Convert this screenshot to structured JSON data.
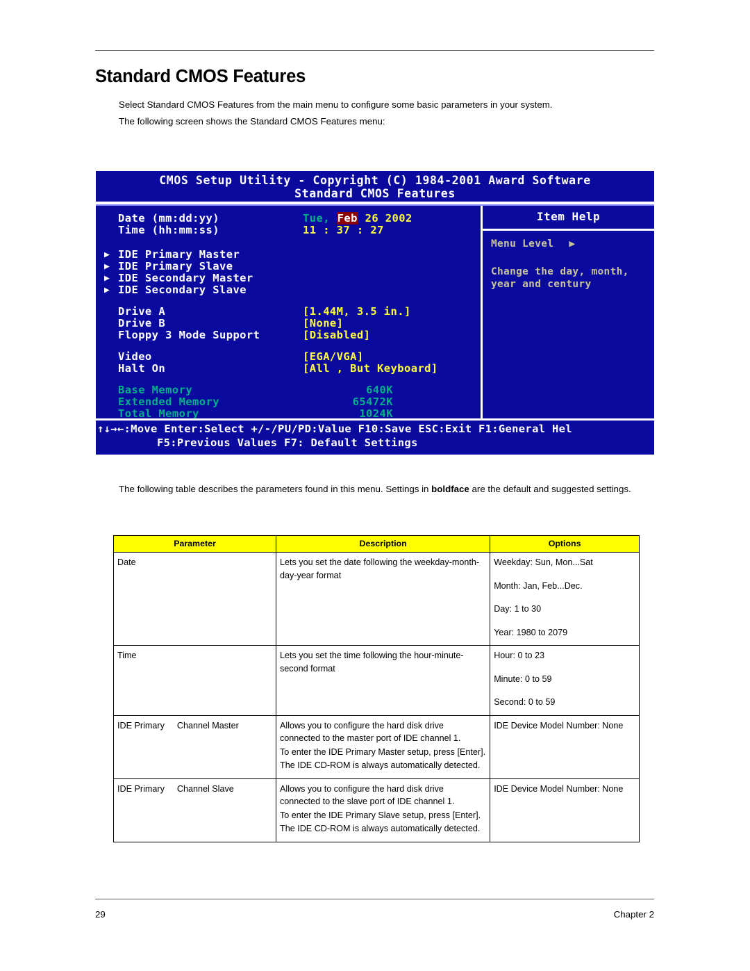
{
  "document": {
    "title": "Standard CMOS Features",
    "intro_line_1": "Select Standard CMOS Features from the main menu to configure some basic parameters in your system.",
    "intro_line_2": "The following screen shows the Standard CMOS Features menu:",
    "table_intro_prefix": "The following table describes the parameters found in this menu.  Settings in ",
    "table_intro_bold": "boldface",
    "table_intro_suffix": " are the default and suggested settings.",
    "footer_page_number": "29",
    "footer_chapter": "Chapter 2"
  },
  "bios": {
    "title_line_1": "CMOS Setup Utility - Copyright (C) 1984-2001 Award Software",
    "title_line_2": "Standard CMOS Features",
    "date": {
      "label": "Date (mm:dd:yy)",
      "weekday": "Tue,",
      "month": "Feb",
      "day_year": "26 2002"
    },
    "time": {
      "label": "Time (hh:mm:ss)",
      "value": "11 : 37 : 27"
    },
    "ide_items": [
      {
        "marker": "▶",
        "label": "IDE Primary Master"
      },
      {
        "marker": "▶",
        "label": "IDE Primary Slave"
      },
      {
        "marker": "▶",
        "label": "IDE Secondary Master"
      },
      {
        "marker": "▶",
        "label": "IDE Secondary Slave"
      }
    ],
    "settings": [
      {
        "label": "Drive A",
        "value": "[1.44M, 3.5 in.]"
      },
      {
        "label": "Drive B",
        "value": "[None]"
      },
      {
        "label": "Floppy 3 Mode Support",
        "value": "[Disabled]"
      }
    ],
    "settings2": [
      {
        "label": "Video",
        "value": "[EGA/VGA]"
      },
      {
        "label": "Halt On",
        "value": "[All , But Keyboard]"
      }
    ],
    "memory": [
      {
        "label": "Base Memory",
        "value": "640K"
      },
      {
        "label": "Extended Memory",
        "value": "65472K"
      },
      {
        "label": "Total Memory",
        "value": "1024K"
      }
    ],
    "item_help": {
      "title": "Item Help",
      "menu_level": "Menu Level",
      "menu_level_arrow": "▶",
      "help_line_1": "Change the day, month,",
      "help_line_2": "year and century"
    },
    "footer": {
      "line_1": "↑↓→←:Move   Enter:Select   +/-/PU/PD:Value   F10:Save   ESC:Exit   F1:General Hel",
      "line_2": "F5:Previous Values                  F7: Default Settings"
    },
    "colors": {
      "background": "#0a0a9e",
      "value_yellow": "#ffff3c",
      "memory_teal": "#00b08a",
      "highlight_red": "#8b0000",
      "help_tan": "#c8c39a"
    }
  },
  "table": {
    "headers": [
      "Parameter",
      "Description",
      "Options"
    ],
    "header_bg": "#ffff00",
    "rows": [
      {
        "parameter": "Date",
        "parameter_suffix": "",
        "description": [
          "Lets you set the date following the weekday-month-day-year format"
        ],
        "options": [
          "Weekday: Sun, Mon...Sat",
          "Month: Jan, Feb...Dec.",
          "Day: 1 to 30",
          "Year: 1980 to 2079"
        ]
      },
      {
        "parameter": "Time",
        "parameter_suffix": "",
        "description": [
          "Lets you set the time following the hour-minute-second format"
        ],
        "options": [
          "Hour: 0 to 23",
          "Minute: 0 to 59",
          "Second: 0 to 59"
        ]
      },
      {
        "parameter": "IDE Primary",
        "parameter_suffix": "Channel Master",
        "description": [
          "Allows you to configure the hard disk drive connected to the master port of IDE channel 1.",
          "To enter the IDE Primary Master setup, press [Enter].",
          "The IDE CD-ROM is always automatically detected."
        ],
        "options": [
          "IDE Device Model Number: None"
        ]
      },
      {
        "parameter": "IDE Primary",
        "parameter_suffix": "Channel Slave",
        "description": [
          " Allows you to configure the hard disk drive connected to the slave port of IDE channel 1.",
          "To enter the IDE Primary Slave setup, press [Enter].",
          "The IDE CD-ROM is always automatically detected."
        ],
        "options": [
          "IDE Device Model Number: None"
        ]
      }
    ]
  }
}
